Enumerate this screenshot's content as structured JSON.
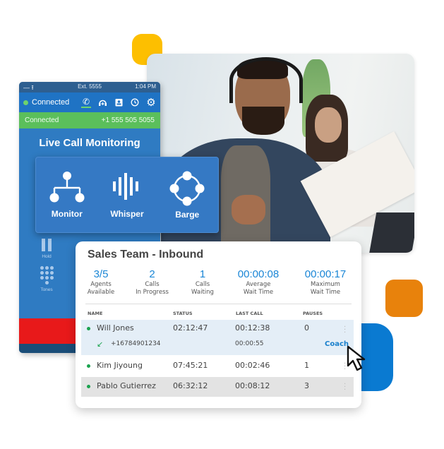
{
  "phone": {
    "titlebar": {
      "controls": "— ⭱",
      "extension": "Ext. 5555",
      "time": "1:04 PM"
    },
    "status": {
      "label": "Connected",
      "icons": [
        "phone-icon",
        "headset-add-icon",
        "contact-card-icon",
        "history-clock-icon",
        "settings-gear-icon"
      ]
    },
    "connection": {
      "label": "Connected",
      "number": "+1 555 505 5055"
    },
    "heading": "Live Call Monitoring",
    "controls": [
      {
        "label": "Hold",
        "icon": "pause-icon"
      },
      {
        "label": "Tones",
        "icon": "keypad-icon"
      }
    ]
  },
  "monitoring": {
    "options": [
      {
        "label": "Monitor",
        "icon": "hierarchy-icon"
      },
      {
        "label": "Whisper",
        "icon": "soundwave-icon"
      },
      {
        "label": "Barge",
        "icon": "circle-nodes-icon"
      }
    ]
  },
  "sales": {
    "title": "Sales Team - Inbound",
    "stats": [
      {
        "value": "3/5",
        "label1": "Agents",
        "label2": "Available"
      },
      {
        "value": "2",
        "label1": "Calls",
        "label2": "In Progress"
      },
      {
        "value": "1",
        "label1": "Calls",
        "label2": "Waiting"
      },
      {
        "value": "00:00:08",
        "label1": "Average",
        "label2": "Wait Time"
      },
      {
        "value": "00:00:17",
        "label1": "Maximum",
        "label2": "Wait Time"
      }
    ],
    "columns": [
      "NAME",
      "STATUS",
      "LAST CALL",
      "PAUSES"
    ],
    "rows": [
      {
        "name": "Will Jones",
        "status": "02:12:47",
        "last_call": "00:12:38",
        "pauses": "0",
        "sub_number": "+16784901234",
        "sub_time": "00:00:55",
        "action": "Coach"
      },
      {
        "name": "Kim Jiyoung",
        "status": "07:45:21",
        "last_call": "00:02:46",
        "pauses": "1"
      },
      {
        "name": "Pablo Gutierrez",
        "status": "06:32:12",
        "last_call": "00:08:12",
        "pauses": "3"
      }
    ]
  },
  "colors": {
    "accent": "#1a86d6",
    "phone_blue": "#2f7bc2",
    "connected_green": "#5bbf5b",
    "end_red": "#e8191a",
    "yellow": "#fdbf00",
    "orange": "#e8820c"
  }
}
